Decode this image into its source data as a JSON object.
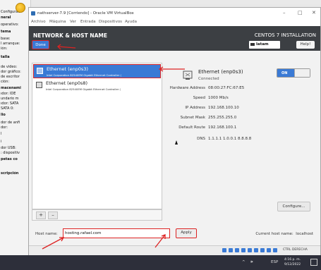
{
  "host": {
    "background_labels": [
      "Configurac",
      "neral",
      "operativo:",
      "tema",
      "base:",
      "l arranque:",
      "ión:",
      "talla",
      "de vídeo:",
      "dor gráfico:",
      "de escritor",
      "ción:",
      "macenami",
      "ıdor: IDE",
      "undario m",
      "ıdor: SATA",
      "SATA 0:",
      "lio",
      "dor de anfi",
      "dor:",
      "l",
      "i",
      "dor USB:",
      ": dispositiv",
      "petas co",
      "scripción"
    ],
    "taskbar": {
      "tray_icons": [
        "^",
        "🕪",
        "ESP"
      ],
      "time": "4:16 p. m.",
      "date": "9/12/2022"
    }
  },
  "vm_window": {
    "title": "nathserver-7.9 [Corriendo] - Oracle VM VirtualBox",
    "controls": [
      "–",
      "□",
      "✕"
    ],
    "menu": [
      "Archivo",
      "Máquina",
      "Ver",
      "Entrada",
      "Dispositivos",
      "Ayuda"
    ],
    "status_bar": {
      "host_key": "CTRL DERECHA"
    }
  },
  "installer": {
    "header": {
      "title": "NETWORK & HOST NAME",
      "done_label": "Done",
      "product": "CENTOS 7 INSTALLATION",
      "keyboard_layout": "latam",
      "help_label": "Help!"
    },
    "devices": [
      {
        "name": "Ethernet (enp0s3)",
        "description": "Intel Corporation 82540EM Gigabit Ethernet Controller (",
        "selected": true
      },
      {
        "name": "Ethernet (enp0s8)",
        "description": "Intel Corporation 82540EM Gigabit Ethernet Controller (",
        "selected": false
      }
    ],
    "list_buttons": {
      "add": "+",
      "remove": "–"
    },
    "detail": {
      "name": "Ethernet (enp0s3)",
      "state": "Connected",
      "toggle": "ON",
      "properties": [
        {
          "key": "Hardware Address",
          "value": "08:00:27:FC:67:E5"
        },
        {
          "key": "Speed",
          "value": "1000 Mb/s"
        },
        {
          "key": "IP Address",
          "value": "192.168.100.10"
        },
        {
          "key": "Subnet Mask",
          "value": "255.255.255.0"
        },
        {
          "key": "Default Route",
          "value": "192.168.100.1"
        },
        {
          "key": "DNS",
          "value": "1.1.1.1 1.0.0.1 8.8.8.8"
        }
      ],
      "configure_label": "Configure..."
    },
    "hostname": {
      "label": "Host name:",
      "value": "hosting.rafael.com",
      "apply_label": "Apply",
      "current_label": "Current host name:",
      "current_value": "localhost"
    }
  },
  "colors": {
    "accent": "#3a7ad5",
    "annotation": "#dd2222",
    "header": "#3c3f43"
  }
}
